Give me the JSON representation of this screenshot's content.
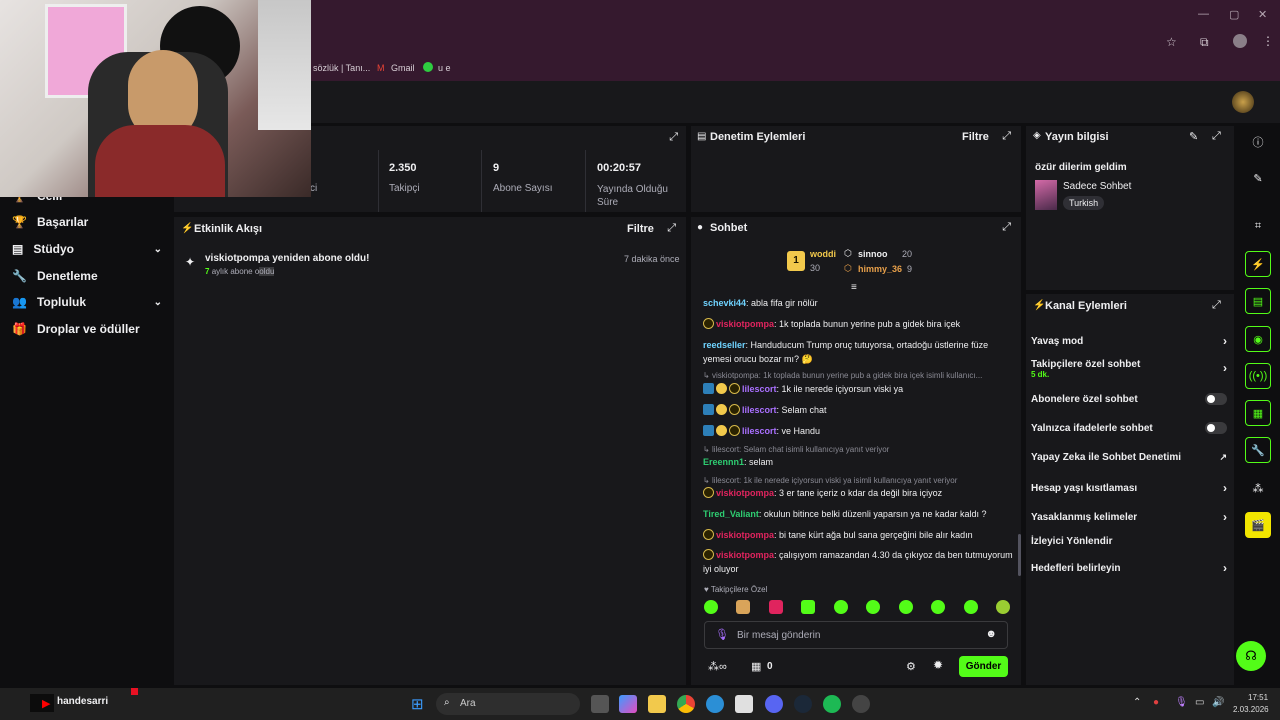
{
  "browser": {
    "bookmarks": [
      "sözlük | Tanı...",
      "Gmail",
      "u e"
    ]
  },
  "sidebar": {
    "items": [
      {
        "label": "Celil"
      },
      {
        "label": "Başarılar"
      },
      {
        "label": "Stüdyo"
      },
      {
        "label": "Denetleme"
      },
      {
        "label": "Topluluk"
      },
      {
        "label": "Droplar ve ödüller"
      }
    ]
  },
  "stats": [
    {
      "value": "2.350",
      "label": "Takipçi"
    },
    {
      "value": "9",
      "label": "Abone Sayısı"
    },
    {
      "value": "00:20:57",
      "label": "Yayında Olduğu Süre"
    }
  ],
  "stats_partial_label": "ci",
  "activity": {
    "title": "Etkinlik Akışı",
    "filter": "Filtre",
    "event_title": "viskiotpompa yeniden abone oldu!",
    "event_count": "7",
    "event_detail": "aylık abone o",
    "event_detail_tail": "oldu",
    "event_time": "7 dakika önce"
  },
  "moderation": {
    "title": "Denetim Eylemleri",
    "filter": "Filtre"
  },
  "stream_info": {
    "title": "Yayın bilgisi",
    "stream_title": "özür dilerim geldim",
    "category": "Sadece Sohbet",
    "tag": "Turkish"
  },
  "chat": {
    "title": "Sohbet",
    "leaderboard": [
      {
        "rank": "1",
        "name": "woddi",
        "score": "30"
      },
      {
        "name": "sinnoo",
        "score": "20"
      },
      {
        "name": "himmy_36",
        "score": "9"
      }
    ],
    "messages": [
      {
        "user": "schevki44",
        "text": ": abla fifa gir nölür"
      },
      {
        "user": "viskiotpompa",
        "text": ": 1k toplada bunun yerine pub a gidek bira içek"
      },
      {
        "user": "reedseller",
        "text": ": Handuducum Trump oruç tutuyorsa, ortadoğu üstlerine füze yemesi orucu bozar mı? 🤔"
      },
      {
        "reply": "viskiotpompa: 1k toplada bunun yerine pub a gidek bira içek isimli kullanıcı...",
        "user": "lilescort",
        "text": ": 1k ile nerede içiyorsun viski ya"
      },
      {
        "user": "lilescort",
        "text": ": Selam chat"
      },
      {
        "user": "lilescort",
        "text": ": ve Handu"
      },
      {
        "reply": "lilescort: Selam chat isimli kullanıcıya yanıt veriyor",
        "user": "Ereennn1",
        "text": ": selam"
      },
      {
        "reply": "lilescort: 1k ile nerede içiyorsun viski ya isimli kullanıcıya yanıt veriyor",
        "user": "viskiotpompa",
        "text": ": 3 er tane içeriz o kdar da değil bira içiyoz"
      },
      {
        "user": "Tired_Valiant",
        "text": ": okulun bitince belki düzenli yaparsın ya ne kadar kaldı ?"
      },
      {
        "user": "viskiotpompa",
        "text": ": bi tane kürt ağa bul sana gerçeğini bile alır kadın"
      },
      {
        "user": "viskiotpompa",
        "text": ": çalışıyom ramazandan 4.30 da çıkıyoz da ben tutmuyorum iyi oluyor"
      }
    ],
    "follower_only_label": "Takipçilere Özel",
    "input_placeholder": "Bir mesaj gönderin",
    "points": "0",
    "send": "Gönder"
  },
  "channel_actions": {
    "title": "Kanal Eylemleri",
    "items": [
      {
        "label": "Yavaş mod"
      },
      {
        "label": "Takipçilere özel sohbet",
        "sub": "5 dk."
      },
      {
        "label": "Abonelere özel sohbet"
      },
      {
        "label": "Yalnızca ifadelerle sohbet"
      },
      {
        "label": "Yapay Zeka ile Sohbet Denetimi"
      },
      {
        "label": "Hesap yaşı kısıtlaması"
      },
      {
        "label": "Yasaklanmış kelimeler"
      },
      {
        "label": "İzleyici Yönlendir"
      },
      {
        "label": "Hedefleri belirleyin"
      }
    ]
  },
  "taskbar": {
    "channel": "handesarri",
    "search": "Ara",
    "time": "17:51",
    "date": "2.03.2026"
  },
  "colors": {
    "accent": "#53fc18",
    "chrome": "#35192e",
    "panel": "#18181b",
    "red_user": "#e0245e",
    "purple_user": "#a970ff",
    "teal_user": "#6fd3ff"
  }
}
